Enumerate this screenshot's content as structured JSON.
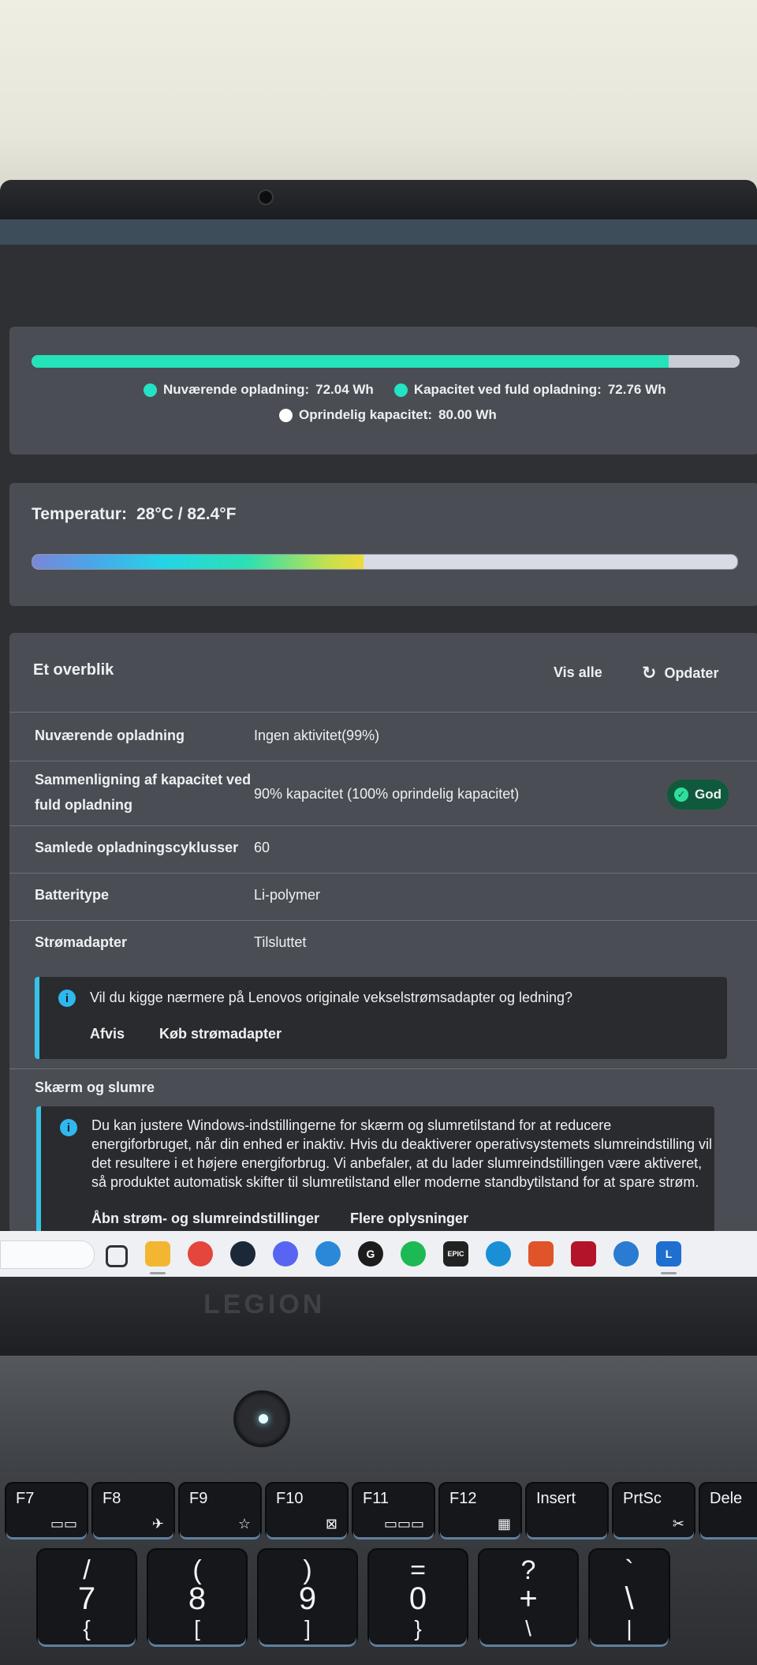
{
  "capacity_card": {
    "fill_fraction": 0.9,
    "legend": [
      {
        "label": "Nuværende opladning:",
        "value": "72.04 Wh",
        "color": "#24e3c4"
      },
      {
        "label": "Kapacitet ved fuld opladning:",
        "value": "72.76 Wh",
        "color": "#24e3c4"
      },
      {
        "label": "Oprindelig kapacitet:",
        "value": "80.00 Wh",
        "color": "#ffffff"
      }
    ]
  },
  "temperature_card": {
    "label": "Temperatur:",
    "value": "28°C / 82.4°F",
    "fill_fraction": 0.47
  },
  "overview": {
    "title": "Et overblik",
    "view_all": "Vis alle",
    "refresh": "Opdater",
    "rows": [
      {
        "label": "Nuværende opladning",
        "value": "Ingen aktivitet(99%)"
      },
      {
        "label_line1": "Sammenligning af kapacitet ved",
        "label_line2": "fuld opladning",
        "value": "90% kapacitet (100% oprindelig kapacitet)",
        "badge": "God"
      },
      {
        "label": "Samlede opladningscyklusser",
        "value": "60"
      },
      {
        "label": "Batteritype",
        "value": "Li-polymer"
      },
      {
        "label": "Strømadapter",
        "value": "Tilsluttet"
      }
    ],
    "info_adapter": {
      "text": "Vil du kigge nærmere på Lenovos originale vekselstrømsadapter og ledning?",
      "dismiss": "Afvis",
      "buy": "Køb strømadapter"
    },
    "section_sleep": "Skærm og slumre",
    "info_sleep": {
      "line1": "Du kan justere Windows-indstillingerne for skærm og slumretilstand for at reducere",
      "line2": "energiforbruget, når din enhed er inaktiv. Hvis du deaktiverer operativsystemets slumreindstilling vil",
      "line3": "det resultere i et højere energiforbrug. Vi anbefaler, at du lader slumreindstillingen være aktiveret,",
      "line4": "så produktet automatisk skifter til slumretilstand eller moderne standbytilstand for at spare strøm.",
      "open_settings": "Åbn strøm- og slumreindstillinger",
      "more_info": "Flere oplysninger"
    }
  },
  "taskbar": {
    "icons": [
      {
        "name": "task-view-icon",
        "glyph": "",
        "color": "#3a3d44"
      },
      {
        "name": "file-explorer-icon",
        "glyph": "",
        "color": "#f2b632"
      },
      {
        "name": "chrome-icon",
        "glyph": "",
        "color": "#e4463b"
      },
      {
        "name": "steam-icon",
        "glyph": "",
        "color": "#1b2838"
      },
      {
        "name": "discord-icon",
        "glyph": "",
        "color": "#5865f2"
      },
      {
        "name": "vpn-icon",
        "glyph": "",
        "color": "#2b87d8"
      },
      {
        "name": "logitech-icon",
        "glyph": "G",
        "color": "#1c1c1c"
      },
      {
        "name": "spotify-icon",
        "glyph": "",
        "color": "#1db954"
      },
      {
        "name": "epic-games-icon",
        "glyph": "EPIC",
        "color": "#222222"
      },
      {
        "name": "app-circle-icon",
        "glyph": "",
        "color": "#1a8fd6"
      },
      {
        "name": "game-launcher-icon",
        "glyph": "",
        "color": "#e0542a"
      },
      {
        "name": "shield-app-icon",
        "glyph": "",
        "color": "#b3142a"
      },
      {
        "name": "cortana-icon",
        "glyph": "",
        "color": "#2a7bd1"
      },
      {
        "name": "lenovo-vantage-icon",
        "glyph": "L",
        "color": "#1f6fd1"
      }
    ]
  },
  "laptop": {
    "brand": "LEGION"
  },
  "keyboard": {
    "fkeys": [
      {
        "key": "F7",
        "symbol": "▭▭"
      },
      {
        "key": "F8",
        "symbol": "✈"
      },
      {
        "key": "F9",
        "symbol": "☆"
      },
      {
        "key": "F10",
        "symbol": "⊠"
      },
      {
        "key": "F11",
        "symbol": "▭▭▭"
      },
      {
        "key": "F12",
        "symbol": "▦"
      },
      {
        "key": "Insert",
        "symbol": ""
      },
      {
        "key": "PrtSc",
        "symbol": "✂"
      },
      {
        "key": "Dele",
        "symbol": ""
      }
    ],
    "numkeys": [
      {
        "top": "/",
        "mid": "7",
        "bot": "{"
      },
      {
        "top": "(",
        "mid": "8",
        "bot": "["
      },
      {
        "top": ")",
        "mid": "9",
        "bot": "]"
      },
      {
        "top": "=",
        "mid": "0",
        "bot": "}"
      },
      {
        "top": "?",
        "mid": "+",
        "bot": "\\"
      },
      {
        "top": "`",
        "mid": "\\",
        "bot": "|"
      }
    ]
  }
}
